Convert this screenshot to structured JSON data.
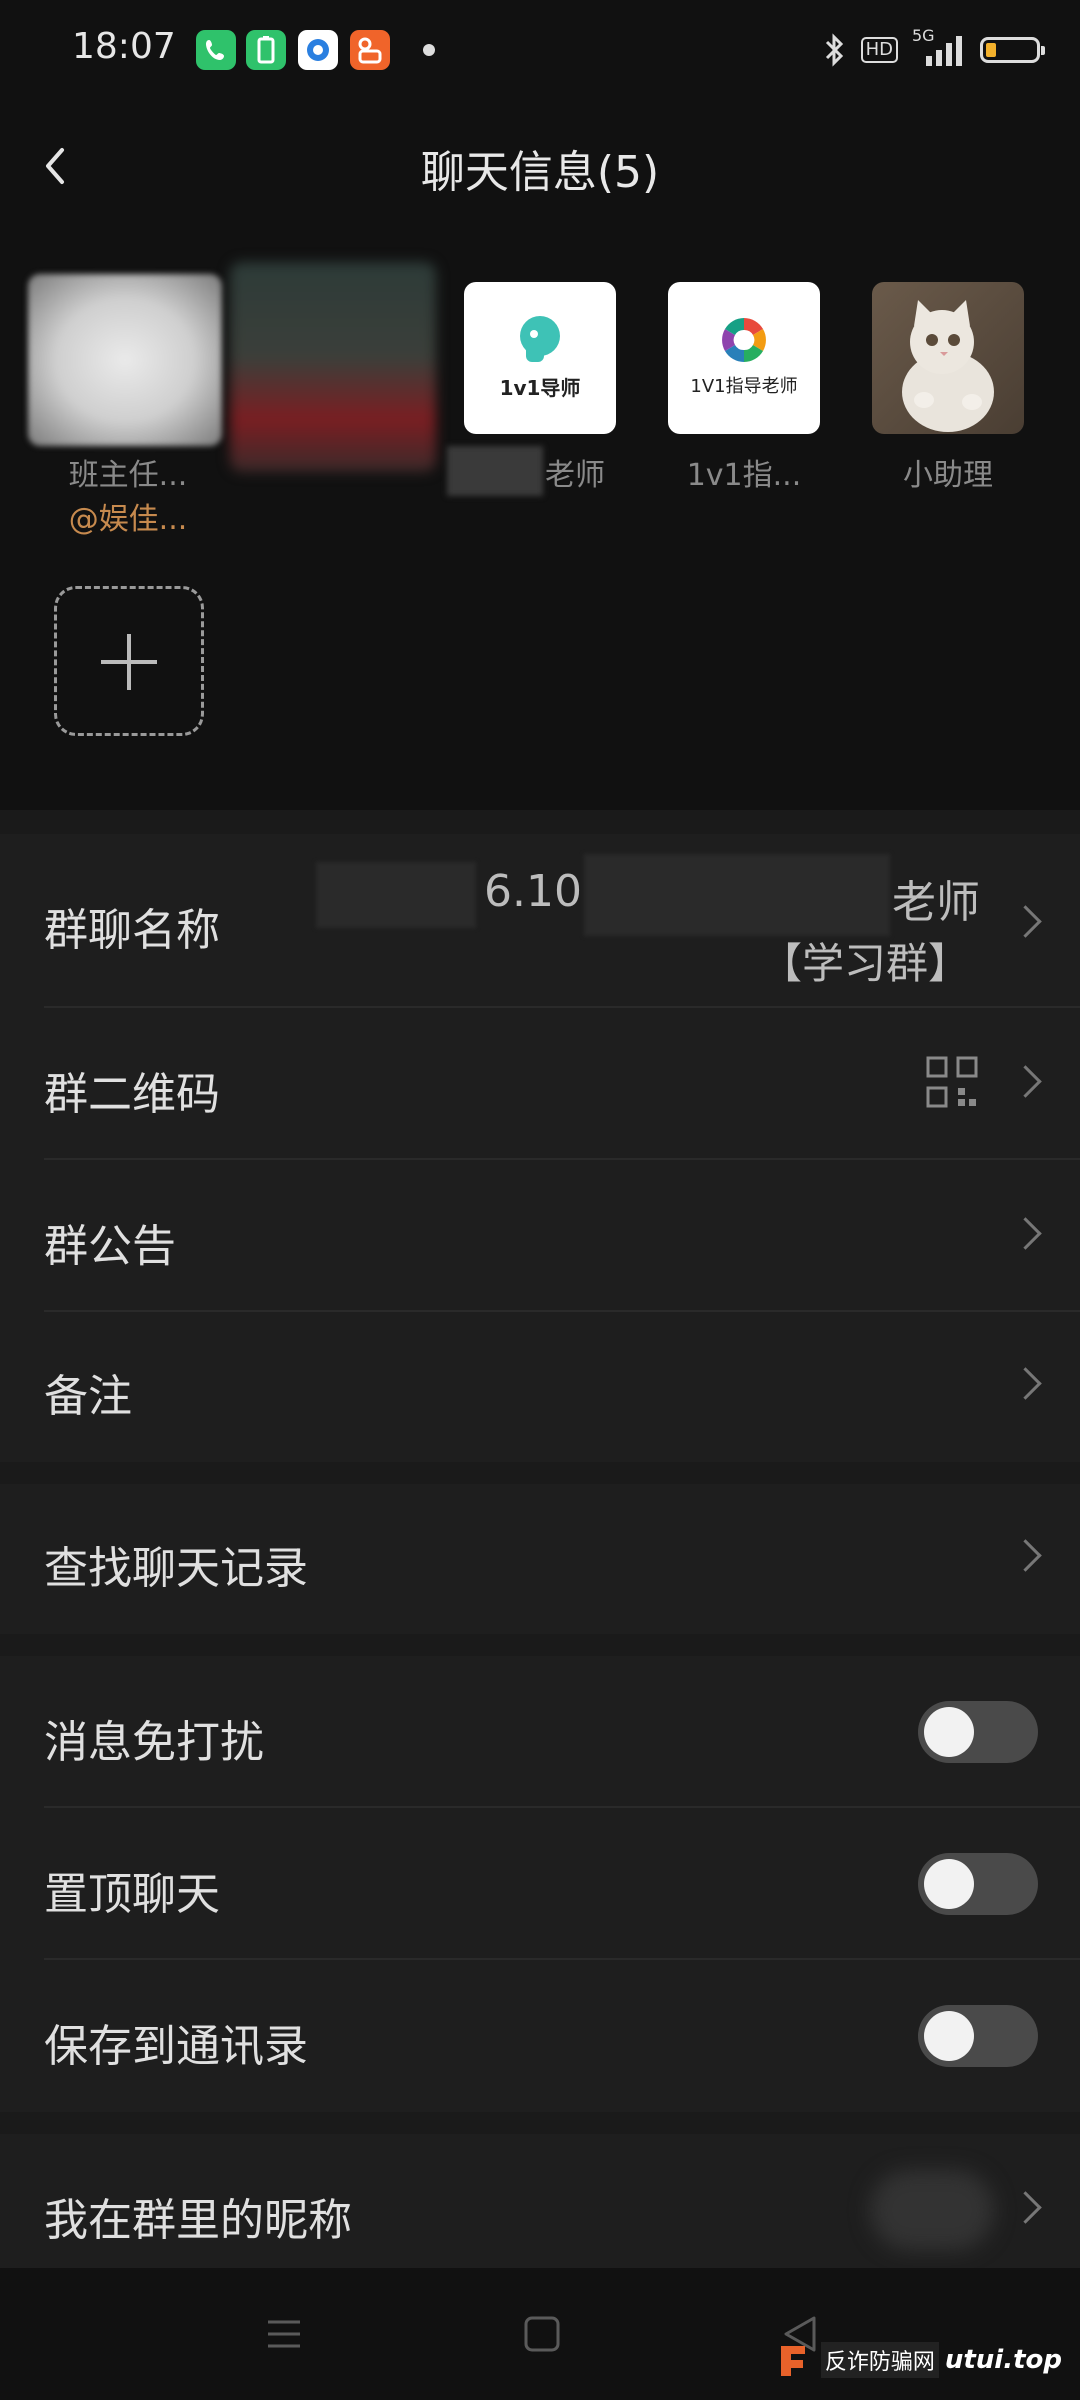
{
  "status_bar": {
    "time": "18:07",
    "apps": [
      "phone-icon",
      "battery-app-icon",
      "browser-icon",
      "store-icon"
    ],
    "hd": "HD",
    "network": "5G",
    "battery_level": 0.15,
    "battery_color": "#f3b12c"
  },
  "header": {
    "back_icon": "chevron-left-icon",
    "title": "聊天信息(5)"
  },
  "members": [
    {
      "name": "班主任...",
      "tag": "@娱佳..."
    },
    {
      "name": "",
      "tag": ""
    },
    {
      "name": "老师",
      "tag": "",
      "logo_text": "1v1导师"
    },
    {
      "name": "1v1指...",
      "tag": "",
      "logo_text": "1V1指导老师"
    },
    {
      "name": "小助理",
      "tag": ""
    }
  ],
  "add_member_icon": "plus-icon",
  "settings": {
    "group_name": {
      "label": "群聊名称",
      "value_line1": "6.10",
      "value_line1_suffix": "老师",
      "value_line2": "【学习群】"
    },
    "qr_code": {
      "label": "群二维码"
    },
    "announcement": {
      "label": "群公告"
    },
    "remark": {
      "label": "备注"
    },
    "search_history": {
      "label": "查找聊天记录"
    },
    "mute": {
      "label": "消息免打扰",
      "on": false
    },
    "pin": {
      "label": "置顶聊天",
      "on": false
    },
    "save_contacts": {
      "label": "保存到通讯录",
      "on": false
    },
    "my_nickname": {
      "label": "我在群里的昵称"
    }
  },
  "nav_bar": {
    "menu_icon": "menu-icon",
    "home_icon": "home-square-icon",
    "back_icon": "back-triangle-icon"
  },
  "watermark": {
    "text": "反诈防骗网",
    "domain": "utui.top",
    "accent": "#e8622a"
  }
}
